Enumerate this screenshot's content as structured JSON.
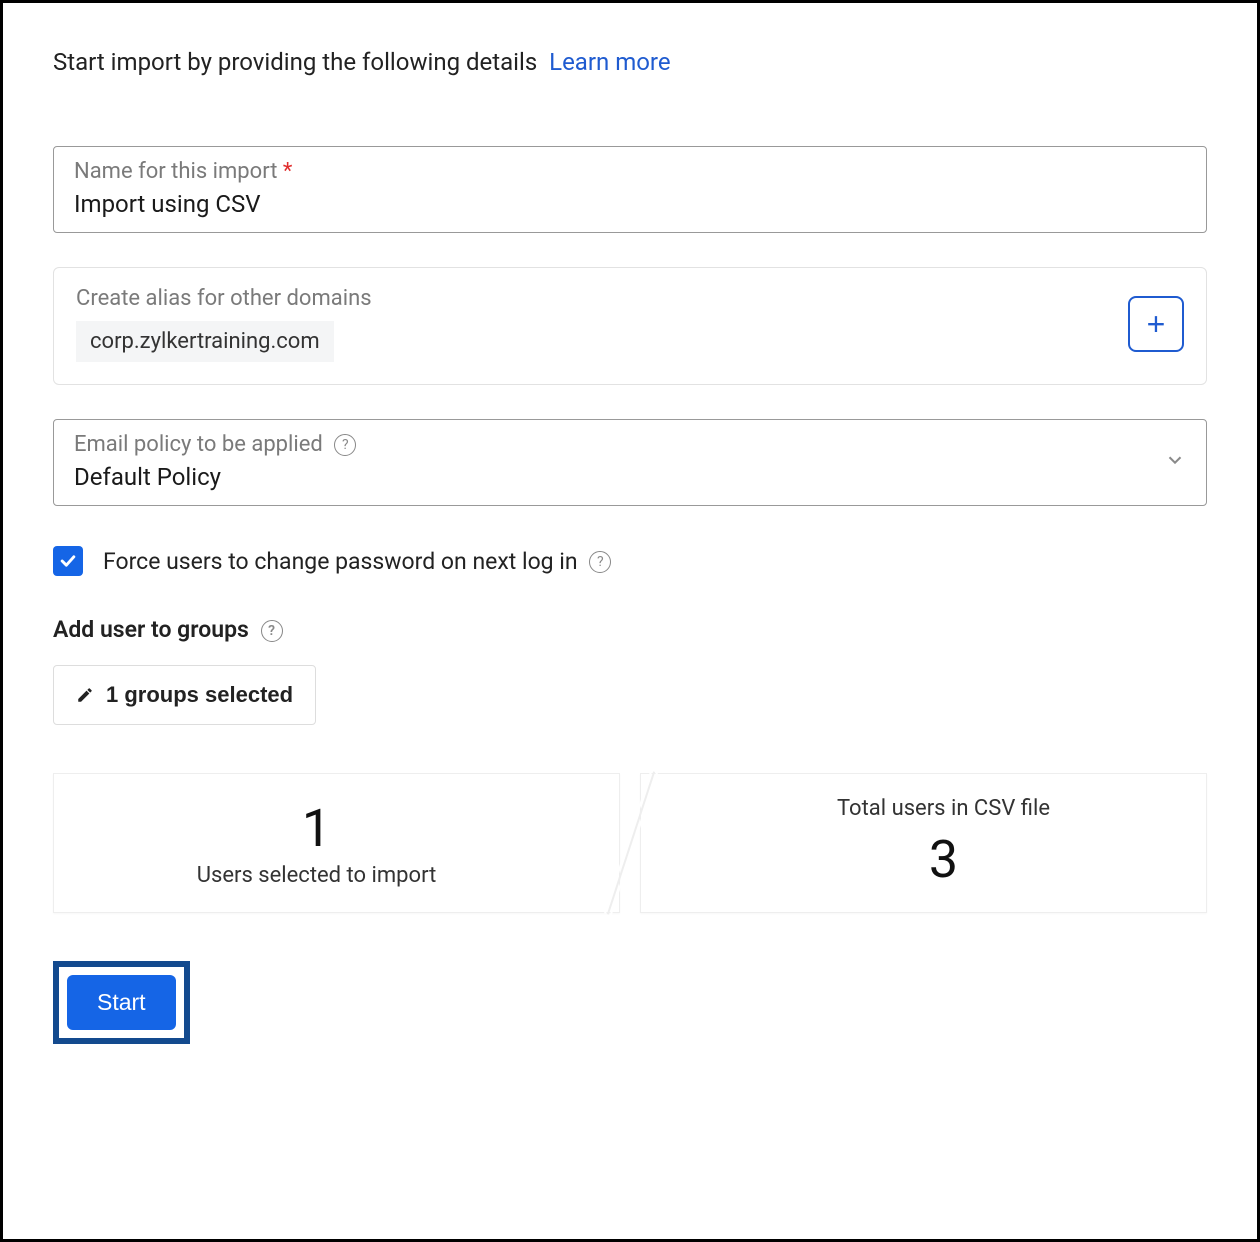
{
  "intro": {
    "text": "Start import by providing the following details",
    "link": "Learn more"
  },
  "nameField": {
    "label": "Name for this import",
    "value": "Import using CSV"
  },
  "aliasField": {
    "label": "Create alias for other domains",
    "chip": "corp.zylkertraining.com"
  },
  "policyField": {
    "label": "Email policy to be applied",
    "value": "Default Policy"
  },
  "forceCheckbox": {
    "label": "Force users to change password on next log in",
    "checked": true
  },
  "groupsSection": {
    "label": "Add user to groups",
    "button": "1 groups selected"
  },
  "stats": {
    "selectedCount": "1",
    "selectedLabel": "Users selected to import",
    "totalLabel": "Total users in CSV file",
    "totalCount": "3"
  },
  "startButton": "Start"
}
